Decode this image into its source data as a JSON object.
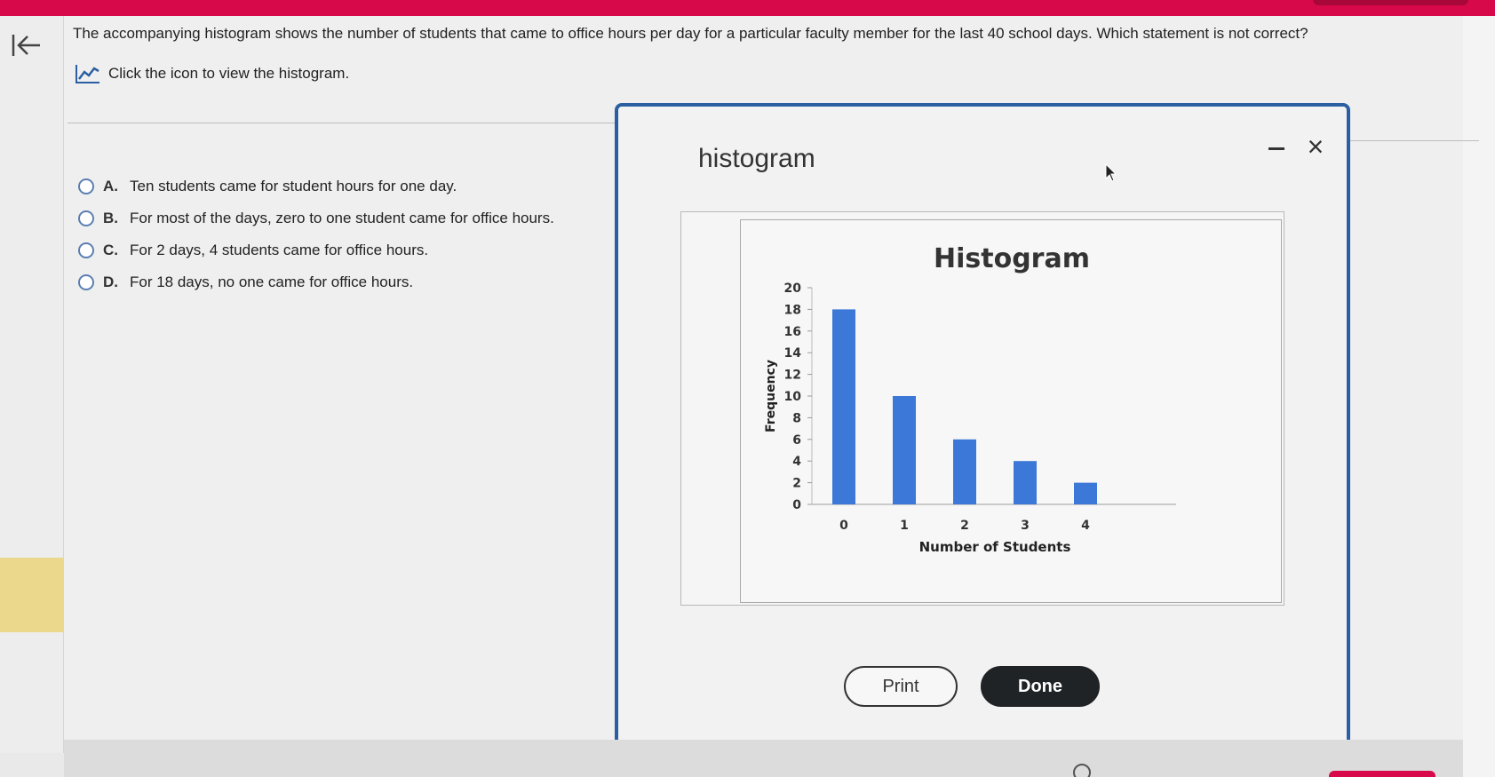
{
  "question": {
    "text": "The accompanying histogram shows the number of students that came to office hours per day for a particular faculty member for the last 40 school days. Which statement is not correct?",
    "link_label": "Click the icon to view the histogram.",
    "link_icon": "line-chart-icon"
  },
  "options": [
    {
      "letter": "A.",
      "text": "Ten students came for student hours for one day."
    },
    {
      "letter": "B.",
      "text": "For most of the days, zero to one student came for office hours."
    },
    {
      "letter": "C.",
      "text": "For 2 days, 4 students came for office hours."
    },
    {
      "letter": "D.",
      "text": "For 18 days, no one came for office hours."
    }
  ],
  "modal": {
    "title": "histogram",
    "minimize_icon": "minimize-icon",
    "close_icon": "close-icon",
    "close_glyph": "×",
    "print_label": "Print",
    "done_label": "Done"
  },
  "colors": {
    "accent": "#d8094a",
    "modal_border": "#2a5fa2",
    "bar": "#3c78d8",
    "done_bg": "#1f2326"
  },
  "chart_data": {
    "type": "bar",
    "title": "Histogram",
    "xlabel": "Number of Students",
    "ylabel": "Frequency",
    "categories": [
      "0",
      "1",
      "2",
      "3",
      "4"
    ],
    "values": [
      18,
      10,
      6,
      4,
      2
    ],
    "ylim": [
      0,
      20
    ],
    "yticks": [
      0,
      2,
      4,
      6,
      8,
      10,
      12,
      14,
      16,
      18,
      20
    ],
    "grid": false,
    "legend": "none"
  }
}
